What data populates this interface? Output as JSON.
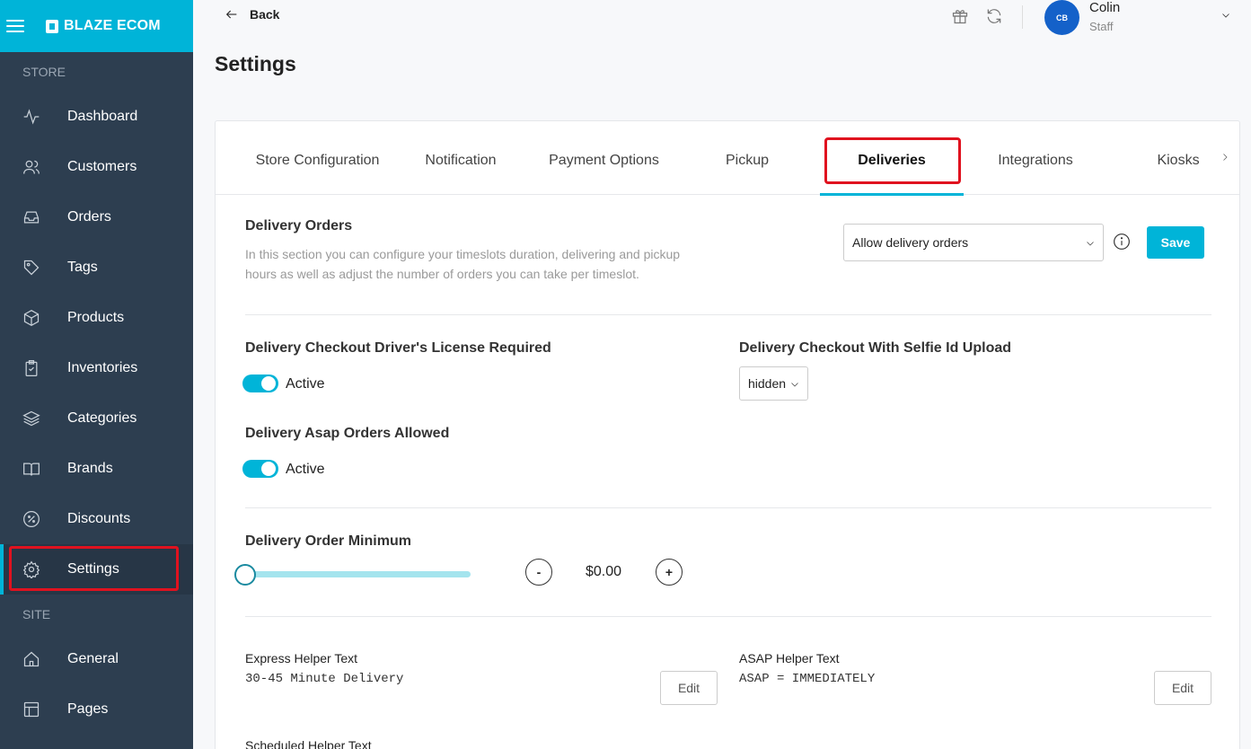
{
  "sidebar": {
    "brand": "BLAZE ECOM",
    "store_label": "STORE",
    "site_label": "SITE",
    "store_items": [
      {
        "label": "Dashboard",
        "icon": "activity-icon"
      },
      {
        "label": "Customers",
        "icon": "users-icon"
      },
      {
        "label": "Orders",
        "icon": "inbox-icon"
      },
      {
        "label": "Tags",
        "icon": "tag-icon"
      },
      {
        "label": "Products",
        "icon": "box-icon"
      },
      {
        "label": "Inventories",
        "icon": "clipboard-check-icon"
      },
      {
        "label": "Categories",
        "icon": "layers-icon"
      },
      {
        "label": "Brands",
        "icon": "book-open-icon"
      },
      {
        "label": "Discounts",
        "icon": "percent-icon"
      },
      {
        "label": "Settings",
        "icon": "gear-icon",
        "active": true
      }
    ],
    "site_items": [
      {
        "label": "General",
        "icon": "home-icon"
      },
      {
        "label": "Pages",
        "icon": "layout-icon"
      }
    ]
  },
  "topbar": {
    "back_label": "Back",
    "user": {
      "initials": "CB",
      "name": "Colin",
      "role": "Staff"
    }
  },
  "page_title": "Settings",
  "tabs": [
    {
      "label": "Store Configuration"
    },
    {
      "label": "Notification"
    },
    {
      "label": "Payment Options"
    },
    {
      "label": "Pickup"
    },
    {
      "label": "Deliveries",
      "active": true
    },
    {
      "label": "Integrations"
    },
    {
      "label": "Kiosks"
    }
  ],
  "delivery_orders": {
    "title": "Delivery Orders",
    "description_line1": "In this section you can configure your timeslots duration, delivering and pickup",
    "description_line2": "hours as well as adjust the number of orders you can take per timeslot.",
    "select_value": "Allow delivery orders",
    "save_label": "Save"
  },
  "license_required": {
    "title": "Delivery Checkout Driver's License Required",
    "state_label": "Active",
    "enabled": true
  },
  "selfie_upload": {
    "title": "Delivery Checkout With Selfie Id Upload",
    "select_value": "hidden"
  },
  "asap_allowed": {
    "title": "Delivery Asap Orders Allowed",
    "state_label": "Active",
    "enabled": true
  },
  "order_minimum": {
    "title": "Delivery Order Minimum",
    "minus_label": "-",
    "plus_label": "+",
    "amount": "$0.00",
    "slider_fraction": 0
  },
  "helpers": {
    "express": {
      "label": "Express Helper Text",
      "value": "30-45 Minute Delivery",
      "edit_label": "Edit"
    },
    "asap": {
      "label": "ASAP Helper Text",
      "value": "ASAP = IMMEDIATELY",
      "edit_label": "Edit"
    },
    "scheduled": {
      "label": "Scheduled Helper Text"
    }
  },
  "colors": {
    "accent": "#00b4d8",
    "sidebar": "#2d3e50",
    "highlight": "#e0121f",
    "avatar": "#1461c9"
  }
}
